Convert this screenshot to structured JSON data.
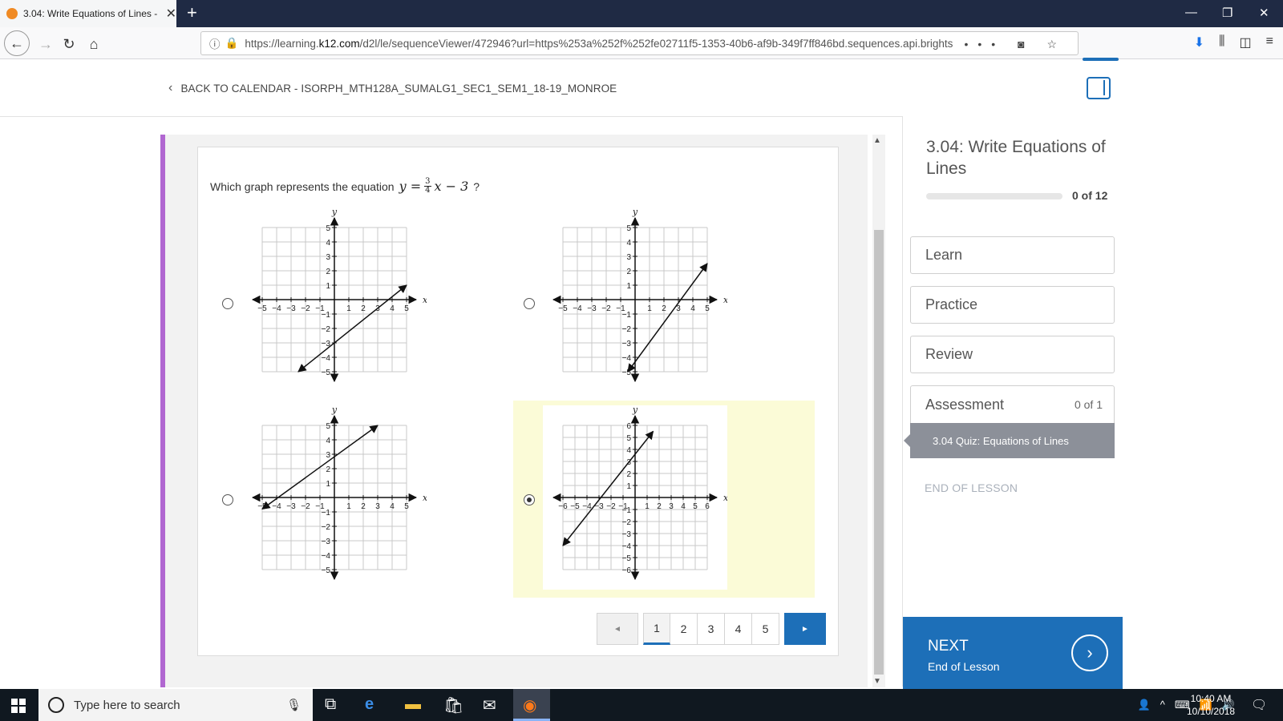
{
  "browser": {
    "tab_title": "3.04: Write Equations of Lines -",
    "url_prefix": "https://learning.",
    "url_domain": "k12.com",
    "url_rest": "/d2l/le/sequenceViewer/472946?url=https%253a%252f%252fe02711f5-1353-40b6-af9b-349f7ff846bd.sequences.api.brights"
  },
  "header": {
    "back_label": "BACK TO CALENDAR - ISORPH_MTH128A_SUMALG1_SEC1_SEM1_18-19_MONROE"
  },
  "question": {
    "prompt": "Which graph represents the equation",
    "eq_lhs": "y =",
    "frac_num": "3",
    "frac_den": "4",
    "eq_rhs": "x − 3",
    "end": "?"
  },
  "graphs": [
    {
      "id": "A",
      "range": 5,
      "line": [
        [
          -2.5,
          -5
        ],
        [
          5,
          1
        ]
      ],
      "selected": false
    },
    {
      "id": "B",
      "range": 5,
      "line": [
        [
          -0.5,
          -5
        ],
        [
          5,
          2.5
        ]
      ],
      "selected": false
    },
    {
      "id": "C",
      "range": 5,
      "line": [
        [
          -5,
          -0.8
        ],
        [
          3,
          5
        ]
      ],
      "selected": false
    },
    {
      "id": "D",
      "range": 6,
      "line": [
        [
          -6,
          -4
        ],
        [
          1.5,
          5.5
        ]
      ],
      "selected": true
    }
  ],
  "axis_labels": {
    "x": "x",
    "y": "y"
  },
  "pager": {
    "prev": "◄",
    "pages": [
      "1",
      "2",
      "3",
      "4",
      "5"
    ],
    "next": "►"
  },
  "panel": {
    "title": "3.04: Write Equations of Lines",
    "progress": "0 of 12",
    "progress_fraction": 0,
    "items": [
      "Learn",
      "Practice",
      "Review"
    ],
    "assessment": "Assessment",
    "assessment_count": "0 of 1",
    "quiz": "3.04 Quiz: Equations of Lines",
    "end_label": "END OF LESSON",
    "next_label": "NEXT",
    "next_sub": "End of Lesson"
  },
  "taskbar": {
    "search_placeholder": "Type here to search",
    "time": "10:40 AM",
    "date": "10/10/2018"
  },
  "colors": {
    "accent": "#1d6fb8",
    "purple": "#b167d1",
    "selected_bg": "#fbfbd7"
  }
}
